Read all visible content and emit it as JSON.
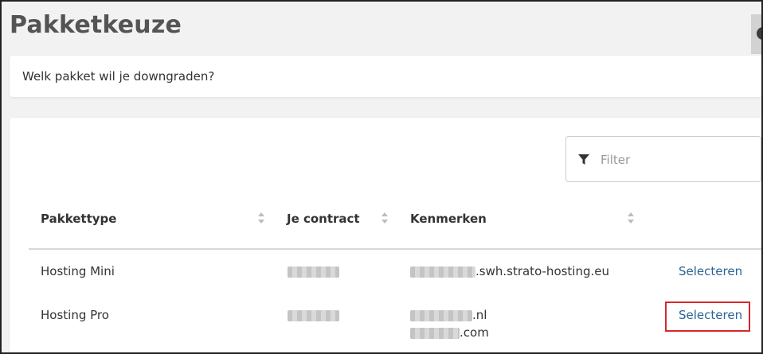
{
  "page": {
    "title": "Pakketkeuze"
  },
  "question": {
    "text": "Welk pakket wil je downgraden?"
  },
  "filter": {
    "placeholder": "Filter",
    "icon": "filter-icon"
  },
  "table": {
    "columns": [
      "Pakkettype",
      "Je contract",
      "Kenmerken"
    ],
    "rows": [
      {
        "type": "Hosting Mini",
        "features": [
          ".swh.strato-hosting.eu"
        ],
        "action": "Selecteren"
      },
      {
        "type": "Hosting Pro",
        "features": [
          ".nl",
          ".com"
        ],
        "action": "Selecteren"
      }
    ]
  },
  "colors": {
    "link": "#2a6496",
    "highlight": "#d9272a"
  }
}
